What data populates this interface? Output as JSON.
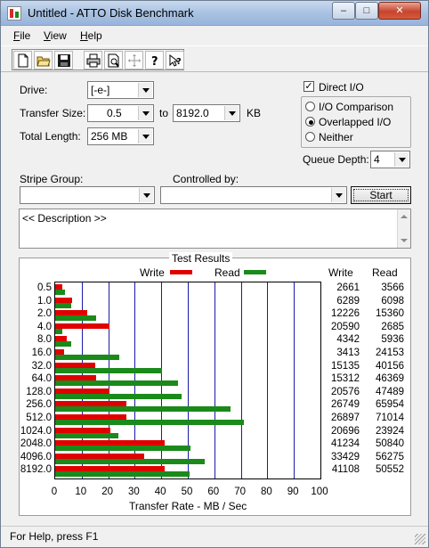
{
  "window": {
    "title": "Untitled - ATTO Disk Benchmark",
    "min_label": "–",
    "max_label": "□",
    "close_label": "✕"
  },
  "menu": [
    {
      "first": "F",
      "rest": "ile"
    },
    {
      "first": "V",
      "rest": "iew"
    },
    {
      "first": "H",
      "rest": "elp"
    }
  ],
  "toolbar": [
    "new-document-icon",
    "open-folder-icon",
    "save-icon",
    "print-icon",
    "print-preview-icon",
    "move-icon",
    "help-icon",
    "context-help-icon"
  ],
  "form": {
    "drive_label": "Drive:",
    "drive_value": "[-e-]",
    "transfer_size_label": "Transfer Size:",
    "transfer_min": "0.5",
    "to_label": "to",
    "transfer_max": "8192.0",
    "kb_label": "KB",
    "total_length_label": "Total Length:",
    "total_length_value": "256 MB",
    "direct_io_label": "Direct I/O",
    "direct_io_checked": true,
    "io_options": [
      {
        "label": "I/O Comparison",
        "selected": false
      },
      {
        "label": "Overlapped I/O",
        "selected": true
      },
      {
        "label": "Neither",
        "selected": false
      }
    ],
    "queue_depth_label": "Queue Depth:",
    "queue_depth_value": "4",
    "stripe_group_label": "Stripe Group:",
    "stripe_group_value": "",
    "controlled_by_label": "Controlled by:",
    "controlled_by_value": "",
    "start_label": "Start",
    "description": "<< Description >>"
  },
  "results": {
    "title": "Test Results",
    "write_legend": "Write",
    "read_legend": "Read",
    "write_header": "Write",
    "read_header": "Read",
    "xlabel": "Transfer Rate - MB / Sec",
    "colors": {
      "write": "#e00000",
      "read": "#1a8a1a",
      "grid": "#1a1aa8"
    }
  },
  "chart_data": {
    "type": "bar",
    "orientation": "horizontal",
    "title": "Test Results",
    "xlabel": "Transfer Rate - MB / Sec",
    "xlim": [
      0,
      100
    ],
    "xticks": [
      0,
      10,
      20,
      30,
      40,
      50,
      60,
      70,
      80,
      90,
      100
    ],
    "categories": [
      "0.5",
      "1.0",
      "2.0",
      "4.0",
      "8.0",
      "16.0",
      "32.0",
      "64.0",
      "128.0",
      "256.0",
      "512.0",
      "1024.0",
      "2048.0",
      "4096.0",
      "8192.0"
    ],
    "series": [
      {
        "name": "Write",
        "color": "#e00000",
        "values": [
          2.661,
          6.289,
          12.226,
          20.59,
          4.342,
          3.413,
          15.135,
          15.312,
          20.576,
          26.749,
          26.897,
          20.696,
          41.234,
          33.429,
          41.108
        ]
      },
      {
        "name": "Read",
        "color": "#1a8a1a",
        "values": [
          3.566,
          6.098,
          15.36,
          2.685,
          5.936,
          24.153,
          40.156,
          46.369,
          47.489,
          65.954,
          71.014,
          23.924,
          50.84,
          56.275,
          50.552
        ]
      }
    ],
    "write_values_printed": [
      "2661",
      "6289",
      "12226",
      "20590",
      "4342",
      "3413",
      "15135",
      "15312",
      "20576",
      "26749",
      "26897",
      "20696",
      "41234",
      "33429",
      "41108"
    ],
    "read_values_printed": [
      "3566",
      "6098",
      "15360",
      "2685",
      "5936",
      "24153",
      "40156",
      "46369",
      "47489",
      "65954",
      "71014",
      "23924",
      "50840",
      "56275",
      "50552"
    ]
  },
  "status": "For Help, press F1"
}
